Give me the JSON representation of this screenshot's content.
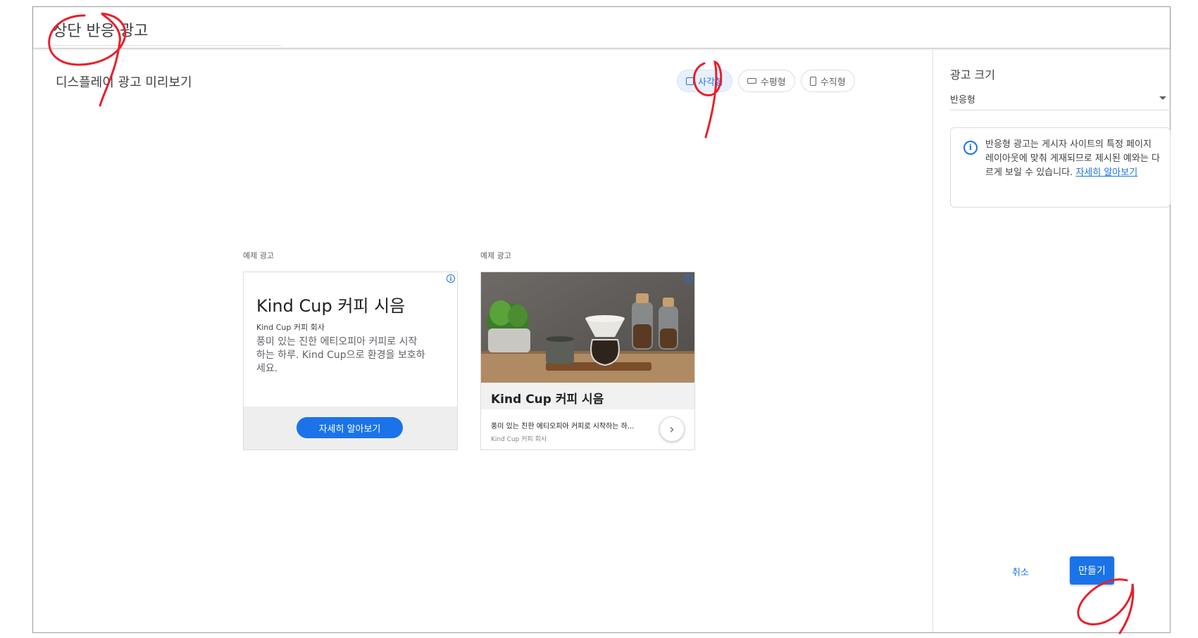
{
  "header": {
    "ad_name": "상단 반응 광고"
  },
  "preview": {
    "title": "디스플레이 광고 미리보기",
    "format_tabs": [
      {
        "label": "사각형",
        "icon": "square-icon",
        "active": true
      },
      {
        "label": "수평형",
        "icon": "horizontal-rect-icon",
        "active": false
      },
      {
        "label": "수직형",
        "icon": "vertical-rect-icon",
        "active": false
      }
    ],
    "samples": [
      {
        "label": "예제 광고",
        "headline": "Kind Cup 커피 시음",
        "business": "Kind Cup 커피 회사",
        "description": "풍미 있는 진한 에티오피아 커피로 시작하는 하루. Kind Cup으로 환경을 보호하세요.",
        "cta": "자세히 알아보기",
        "adchoices_icon": "info-icon"
      },
      {
        "label": "예제 광고",
        "headline": "Kind Cup 커피 시음",
        "description": "풍미 있는 진한 에티오피아 커피로 시작하는 하...",
        "business": "Kind Cup 커피 회사",
        "next_icon": "chevron-right-icon",
        "adchoices_icon": "info-icon"
      }
    ]
  },
  "sidebar": {
    "title": "광고 크기",
    "size_select": {
      "value": "반응형"
    },
    "info": {
      "text": "반응형 광고는 게시자 사이트의 특정 페이지 레이아웃에 맞춰 게재되므로 제시된 예와는 다르게 보일 수 있습니다. ",
      "link": "자세히 알아보기"
    }
  },
  "actions": {
    "cancel": "취소",
    "create": "만들기"
  },
  "colors": {
    "accent": "#1a73e8",
    "annotation": "#e8202a"
  }
}
